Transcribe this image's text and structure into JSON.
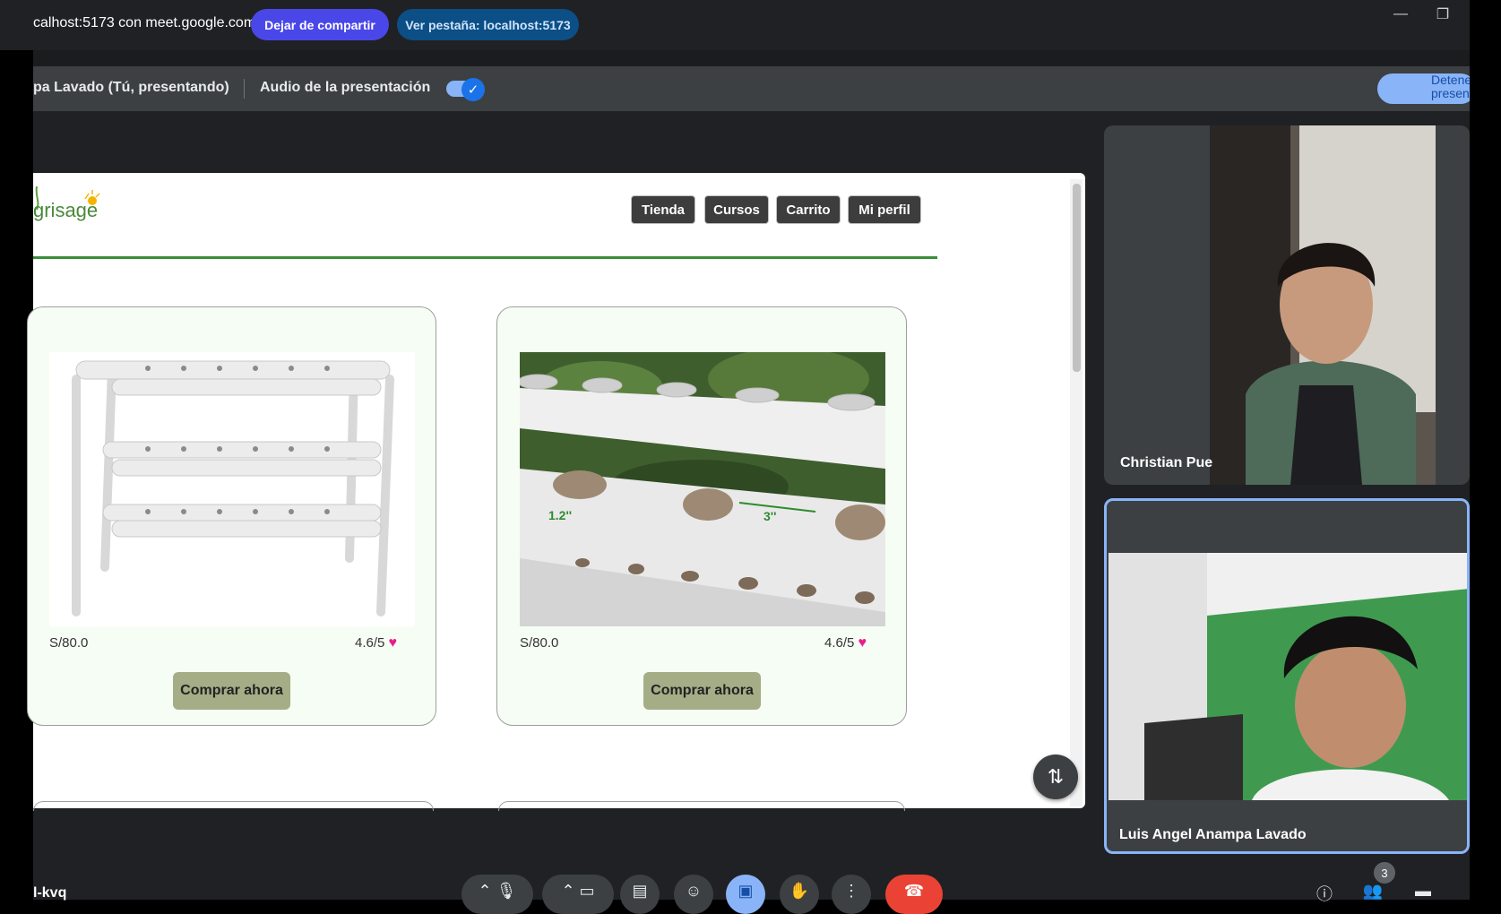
{
  "share_bar": {
    "text": "calhost:5173 con meet.google.com",
    "stop_sharing": "Dejar de compartir",
    "view_tab": "Ver pestaña: localhost:5173"
  },
  "presentation_bar": {
    "presenter": "pa Lavado (Tú, presentando)",
    "audio_label": "Audio de la presentación",
    "audio_enabled": true,
    "stop_button": "Detener presentación"
  },
  "webpage": {
    "logo_text": "grisage",
    "nav": [
      "Tienda",
      "Cursos",
      "Carrito",
      "Mi perfil"
    ],
    "products": [
      {
        "price": "S/80.0",
        "rating": "4.6/5",
        "buy": "Comprar ahora",
        "image": "pvc-rack-three-tier"
      },
      {
        "price": "S/80.0",
        "rating": "4.6/5",
        "buy": "Comprar ahora",
        "image": "pvc-pipe-closeup",
        "labels": [
          "1.2''",
          "3''"
        ]
      }
    ]
  },
  "participants": [
    {
      "name": "Christian Pue"
    },
    {
      "name": "Luis Angel Anampa Lavado"
    }
  ],
  "meeting_code": "l-kvq",
  "people_count": "3",
  "colors": {
    "accent": "#8ab4f8",
    "stop_share": "#4a47e8",
    "end_call": "#ea4335",
    "nav_btn": "#3d3d3d",
    "buy_btn": "#a5ad87"
  }
}
